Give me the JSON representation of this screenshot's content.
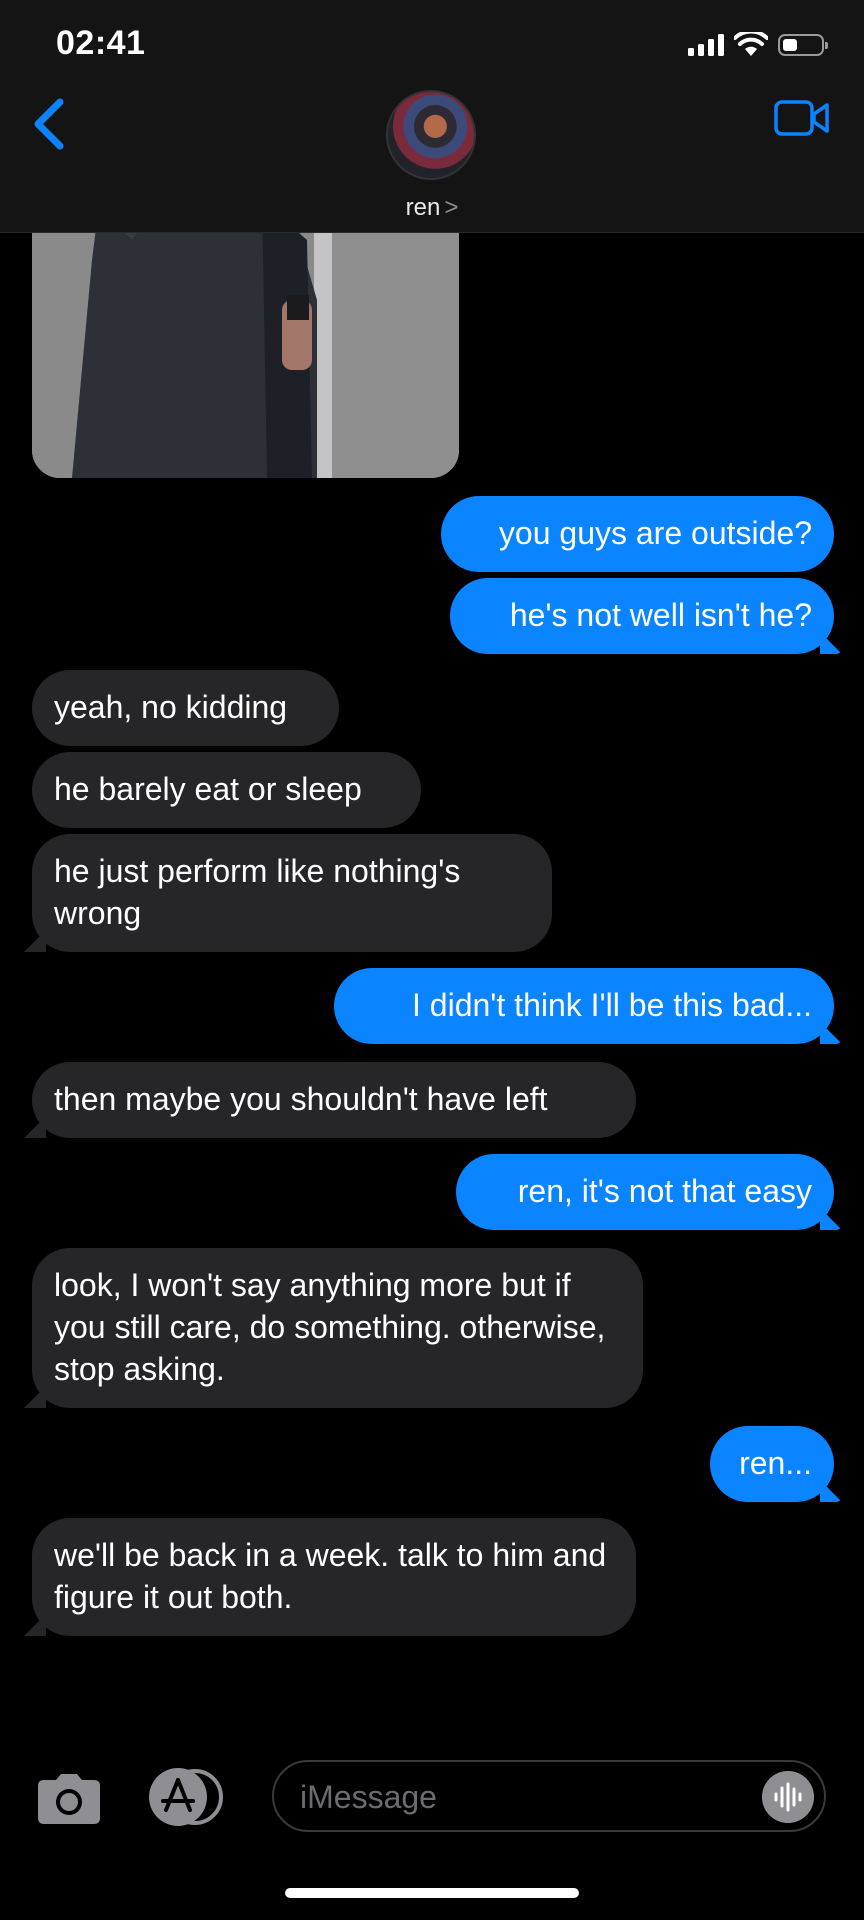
{
  "status_bar": {
    "time": "02:41",
    "battery_level": 0.4,
    "signal_icon": "cellular-bars-icon",
    "wifi_icon": "wifi-icon",
    "battery_icon": "battery-icon"
  },
  "header": {
    "contact_name": "ren",
    "chevron": ">",
    "back_icon": "chevron-left-icon",
    "video_icon": "facetime-video-icon",
    "avatar_icon": "contact-avatar"
  },
  "messages": [
    {
      "side": "out",
      "text": "you guys are outside?"
    },
    {
      "side": "out",
      "text": "he's not well isn't he?"
    },
    {
      "side": "in",
      "text": "yeah, no kidding"
    },
    {
      "side": "in",
      "text": "he barely eat or sleep"
    },
    {
      "side": "in",
      "text": "he just perform like nothing's wrong"
    },
    {
      "side": "out",
      "text": "I didn't think I'll be this bad..."
    },
    {
      "side": "in",
      "text": "then maybe you shouldn't have left"
    },
    {
      "side": "out",
      "text": "ren, it's not that easy"
    },
    {
      "side": "in",
      "text": "look, I won't say anything more but if you still care, do something. otherwise, stop asking."
    },
    {
      "side": "out",
      "text": "ren..."
    },
    {
      "side": "in",
      "text": "we'll be back in a week. talk to him and figure it out both."
    }
  ],
  "input": {
    "placeholder": "iMessage",
    "camera_icon": "camera-icon",
    "appstore_icon": "app-store-icon",
    "audio_icon": "audio-waveform-icon"
  },
  "colors": {
    "outgoing_bubble": "#0a84ff",
    "incoming_bubble": "#262629",
    "accent": "#0a84ff",
    "background": "#000000"
  }
}
